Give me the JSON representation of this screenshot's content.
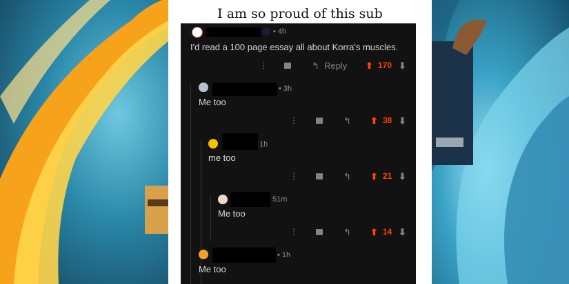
{
  "title": "I am so proud of this sub",
  "comments": [
    {
      "time": "• 4h",
      "body": "I'd read a 100 page essay all about Korra's muscles.",
      "reply": "Reply",
      "score": "170"
    },
    {
      "time": "• 3h",
      "body": "Me too",
      "score": "38"
    },
    {
      "time": "1h",
      "body": "me too",
      "score": "21"
    },
    {
      "time": "51m",
      "body": "Me too",
      "score": "14"
    },
    {
      "time": "• 1h",
      "body": "Me too"
    }
  ],
  "icons": {
    "more": "more-icon",
    "gift": "award-icon",
    "reply": "reply-icon",
    "upvote": "upvote-arrow-icon",
    "downvote": "downvote-arrow-icon"
  },
  "colors": {
    "upvote": "#ff4500",
    "background": "#121212",
    "text": "#d7dadc"
  }
}
